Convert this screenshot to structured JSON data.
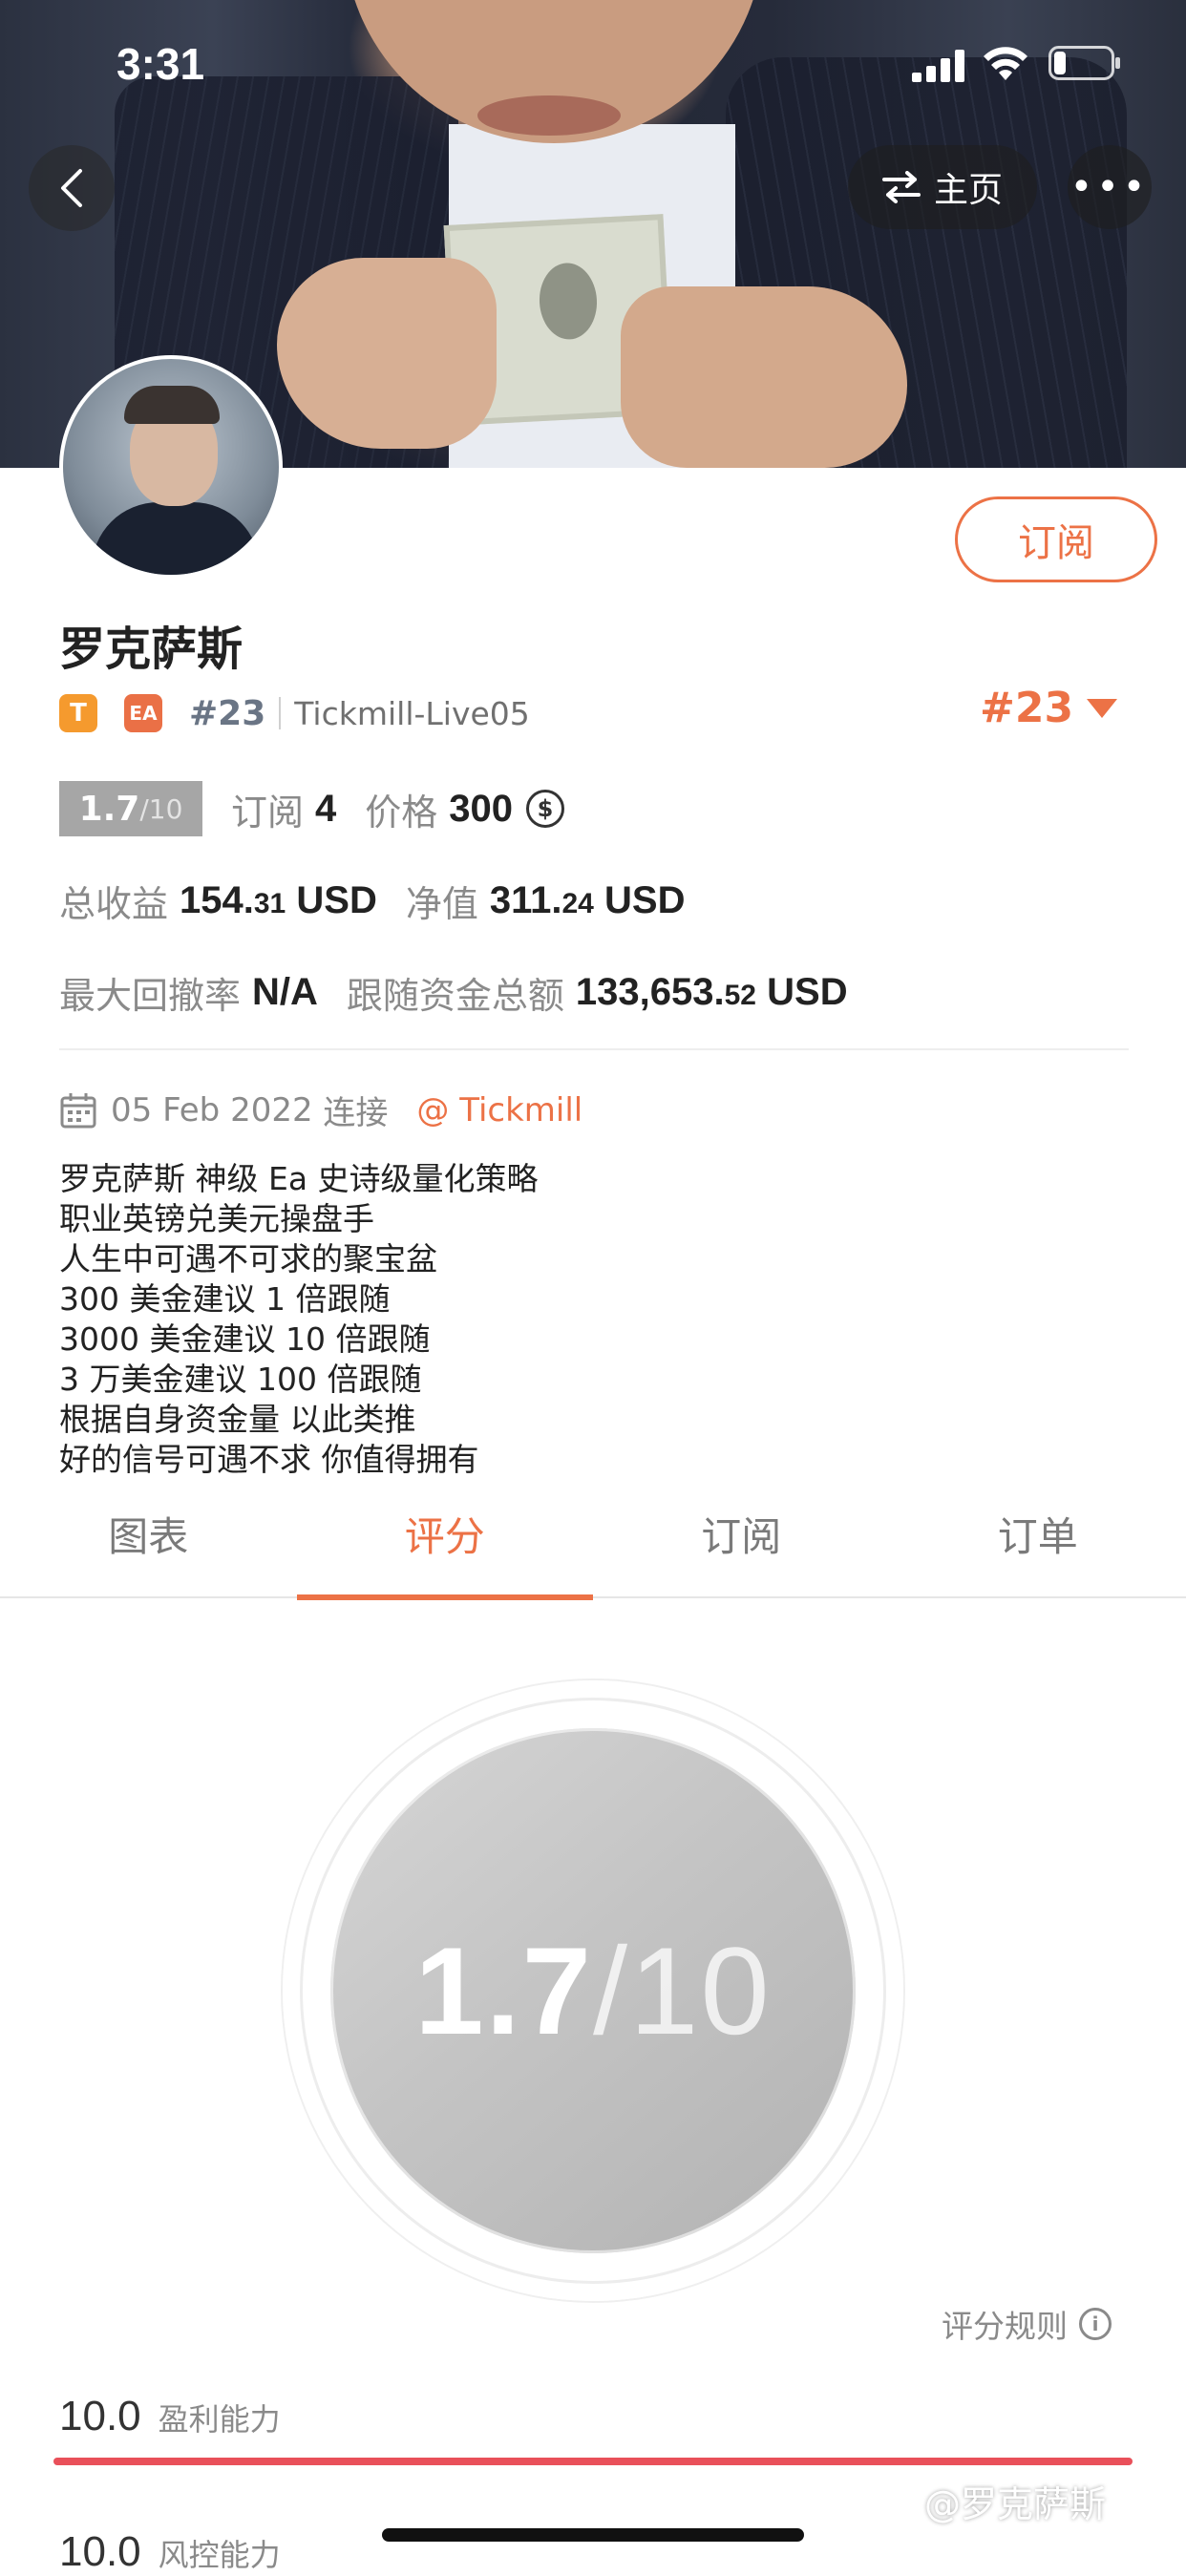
{
  "status_bar": {
    "time": "3:31"
  },
  "header": {
    "home_label": "主页",
    "more_label": "•••"
  },
  "profile": {
    "name": "罗克萨斯",
    "subscribe_label": "订阅",
    "badges": [
      "T",
      "EA"
    ],
    "rank": "#23",
    "server": "Tickmill-Live05",
    "rank_highlight": "#23"
  },
  "stats": {
    "score": "1.7",
    "score_max": "/10",
    "subscriptions_label": "订阅",
    "subscriptions": "4",
    "price_label": "价格",
    "price": "300",
    "coin_symbol": "$",
    "total_profit_label": "总收益",
    "total_profit_int": "154.",
    "total_profit_dec": "31",
    "total_profit_unit": "USD",
    "equity_label": "净值",
    "equity_int": "311.",
    "equity_dec": "24",
    "equity_unit": "USD",
    "max_drawdown_label": "最大回撤率",
    "max_drawdown": "N/A",
    "follow_funds_label": "跟随资金总额",
    "follow_funds_int": "133,653.",
    "follow_funds_dec": "52",
    "follow_funds_unit": "USD"
  },
  "connection": {
    "date": "05 Feb 2022",
    "connected_label": "连接",
    "broker": "@ Tickmill"
  },
  "description": [
    "罗克萨斯 神级 Ea 史诗级量化策略",
    "职业英镑兑美元操盘手",
    "人生中可遇不可求的聚宝盆",
    "300 美金建议 1 倍跟随",
    "3000 美金建议 10 倍跟随",
    "3 万美金建议 100 倍跟随",
    "根据自身资金量 以此类推",
    "好的信号可遇不求 你值得拥有"
  ],
  "tabs": [
    {
      "label": "图表"
    },
    {
      "label": "评分"
    },
    {
      "label": "订阅"
    },
    {
      "label": "订单"
    }
  ],
  "active_tab": "评分",
  "rating": {
    "score": "1.7",
    "denominator": "/10",
    "rules_label": "评分规则",
    "metrics": [
      {
        "value": "10.0",
        "label": "盈利能力",
        "fraction": 1.0,
        "color": "#e9505a"
      },
      {
        "value": "10.0",
        "label": "风控能力"
      }
    ]
  },
  "watermark": "@罗克萨斯",
  "colors": {
    "accent": "#ec7246",
    "bar": "#e9505a",
    "score_chip": "#a6a6a6"
  }
}
